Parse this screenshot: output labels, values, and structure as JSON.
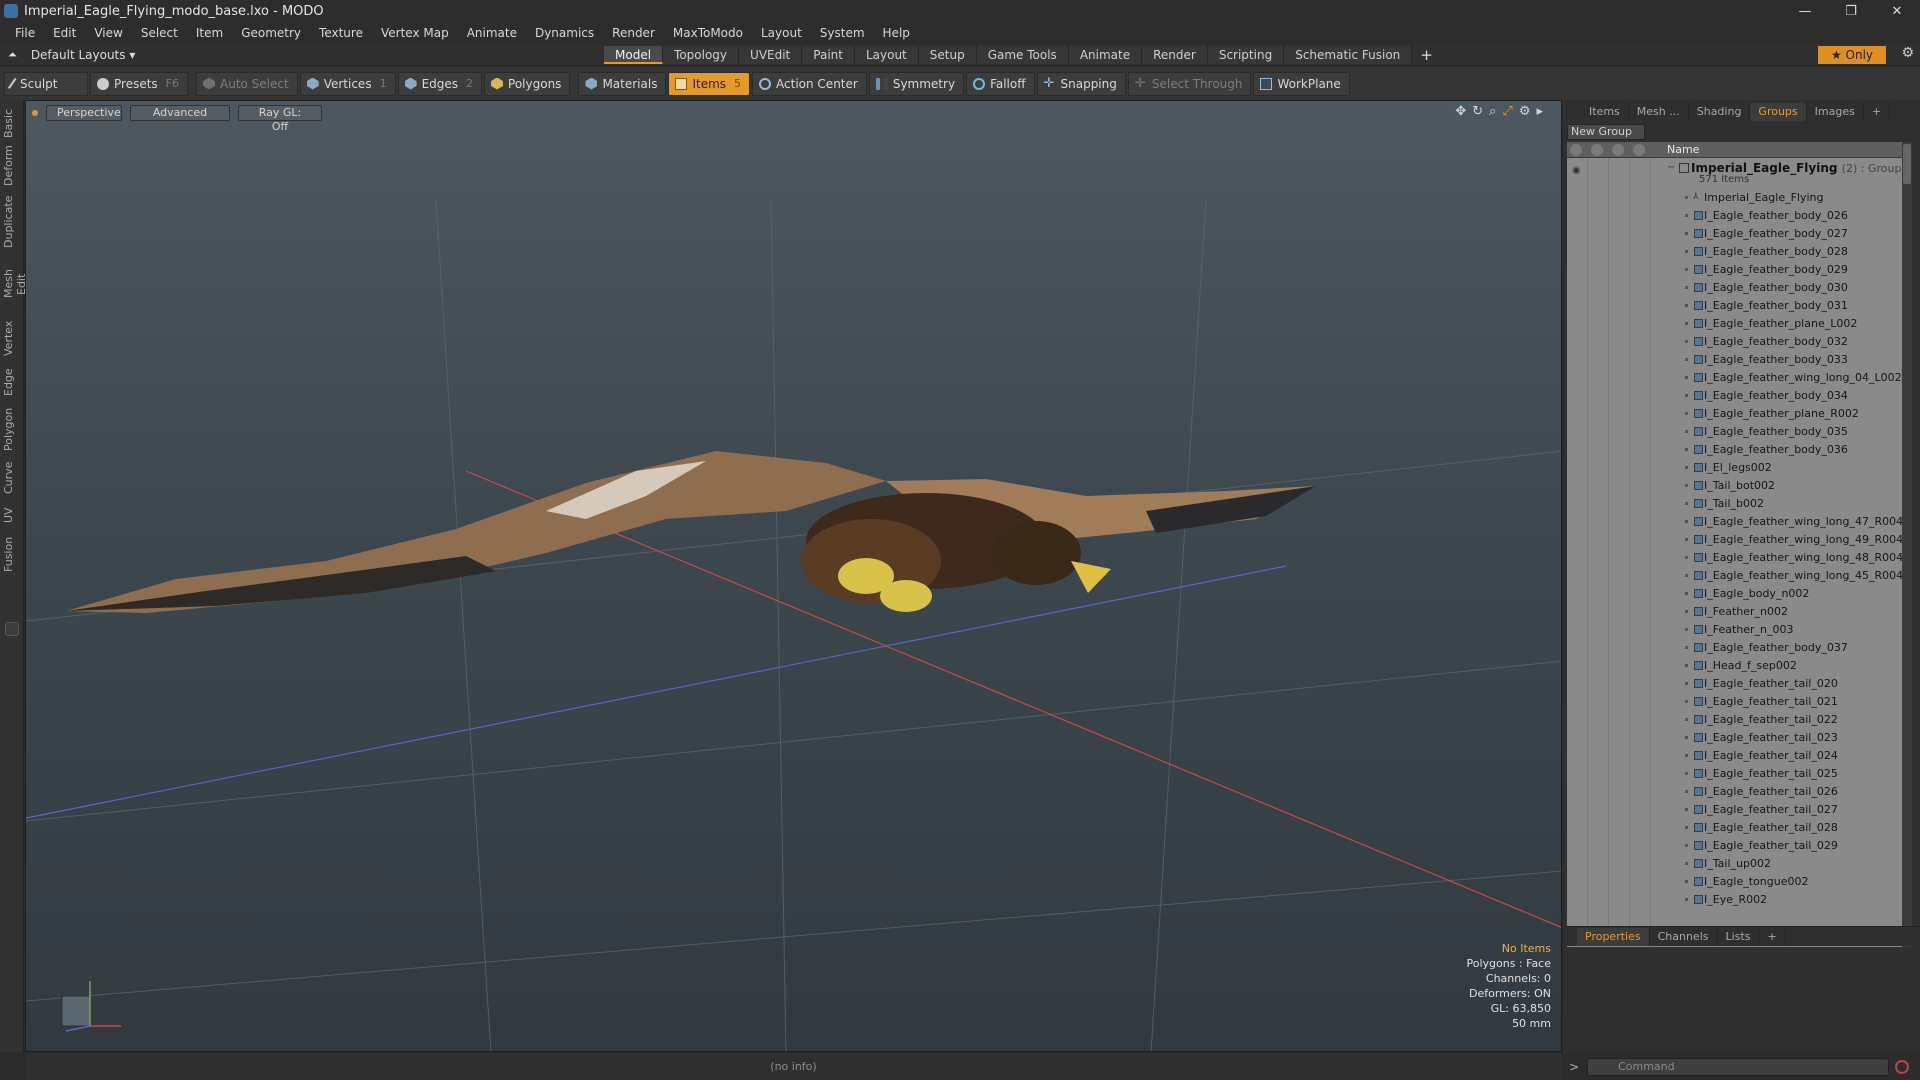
{
  "window": {
    "title": "Imperial_Eagle_Flying_modo_base.lxo - MODO",
    "min": "—",
    "max": "❐",
    "close": "✕"
  },
  "menu": [
    "File",
    "Edit",
    "View",
    "Select",
    "Item",
    "Geometry",
    "Texture",
    "Vertex Map",
    "Animate",
    "Dynamics",
    "Render",
    "MaxToModo",
    "Layout",
    "System",
    "Help"
  ],
  "layoutbar": {
    "layout_select": "Default Layouts ▾",
    "tabs": [
      "Model",
      "Topology",
      "UVEdit",
      "Paint",
      "Layout",
      "Setup",
      "Game Tools",
      "Animate",
      "Render",
      "Scripting",
      "Schematic Fusion"
    ],
    "active_tab": "Model",
    "add": "+",
    "only": "★  Only"
  },
  "toolbar": {
    "sculpt": "Sculpt",
    "presets": "Presets",
    "presets_key": "F6",
    "auto_select": "Auto Select",
    "vertices": "Vertices",
    "vertices_key": "1",
    "edges": "Edges",
    "edges_key": "2",
    "polygons": "Polygons",
    "materials": "Materials",
    "items": "Items",
    "items_key": "5",
    "action_center": "Action Center",
    "symmetry": "Symmetry",
    "falloff": "Falloff",
    "snapping": "Snapping",
    "select_through": "Select Through",
    "workplane": "WorkPlane"
  },
  "leftstrip": [
    "Basic",
    "Deform",
    "Duplicate",
    "Mesh Edit",
    "Vertex",
    "Edge",
    "Polygon",
    "Curve",
    "UV",
    "Fusion"
  ],
  "viewport": {
    "perspective": "Perspective",
    "advanced": "Advanced",
    "raygl": "Ray GL: Off",
    "info": {
      "no_items": "No Items",
      "polygons": "Polygons : Face",
      "channels": "Channels: 0",
      "deformers": "Deformers: ON",
      "gl": "GL: 63,850",
      "focal": "50 mm"
    },
    "status": "(no info)"
  },
  "rightpanel": {
    "tabs": [
      "Items",
      "Mesh ...",
      "Shading",
      "Groups",
      "Images"
    ],
    "active_tab": "Groups",
    "new_group": "New Group",
    "name_col": "Name",
    "group": {
      "name": "Imperial_Eagle_Flying",
      "type": "(2) : Group",
      "count": "571 Items"
    },
    "items": [
      "Imperial_Eagle_Flying",
      "I_Eagle_feather_body_026",
      "I_Eagle_feather_body_027",
      "I_Eagle_feather_body_028",
      "I_Eagle_feather_body_029",
      "I_Eagle_feather_body_030",
      "I_Eagle_feather_body_031",
      "I_Eagle_feather_plane_L002",
      "I_Eagle_feather_body_032",
      "I_Eagle_feather_body_033",
      "I_Eagle_feather_wing_long_04_L002",
      "I_Eagle_feather_body_034",
      "I_Eagle_feather_plane_R002",
      "I_Eagle_feather_body_035",
      "I_Eagle_feather_body_036",
      "I_El_legs002",
      "I_Tail_bot002",
      "I_Tail_b002",
      "I_Eagle_feather_wing_long_47_R004",
      "I_Eagle_feather_wing_long_49_R004",
      "I_Eagle_feather_wing_long_48_R004",
      "I_Eagle_feather_wing_long_45_R004",
      "I_Eagle_body_n002",
      "I_Feather_n002",
      "I_Feather_n_003",
      "I_Eagle_feather_body_037",
      "I_Head_f_sep002",
      "I_Eagle_feather_tail_020",
      "I_Eagle_feather_tail_021",
      "I_Eagle_feather_tail_022",
      "I_Eagle_feather_tail_023",
      "I_Eagle_feather_tail_024",
      "I_Eagle_feather_tail_025",
      "I_Eagle_feather_tail_026",
      "I_Eagle_feather_tail_027",
      "I_Eagle_feather_tail_028",
      "I_Eagle_feather_tail_029",
      "I_Tail_up002",
      "I_Eagle_tongue002",
      "I_Eye_R002"
    ],
    "prop_tabs": [
      "Properties",
      "Channels",
      "Lists"
    ],
    "prop_active": "Properties",
    "command_placeholder": "Command"
  },
  "colors": {
    "accent": "#e59b2c",
    "x_axis": "#c94a4a",
    "z_axis": "#5a66c8",
    "y_axis": "#7aa05a"
  }
}
